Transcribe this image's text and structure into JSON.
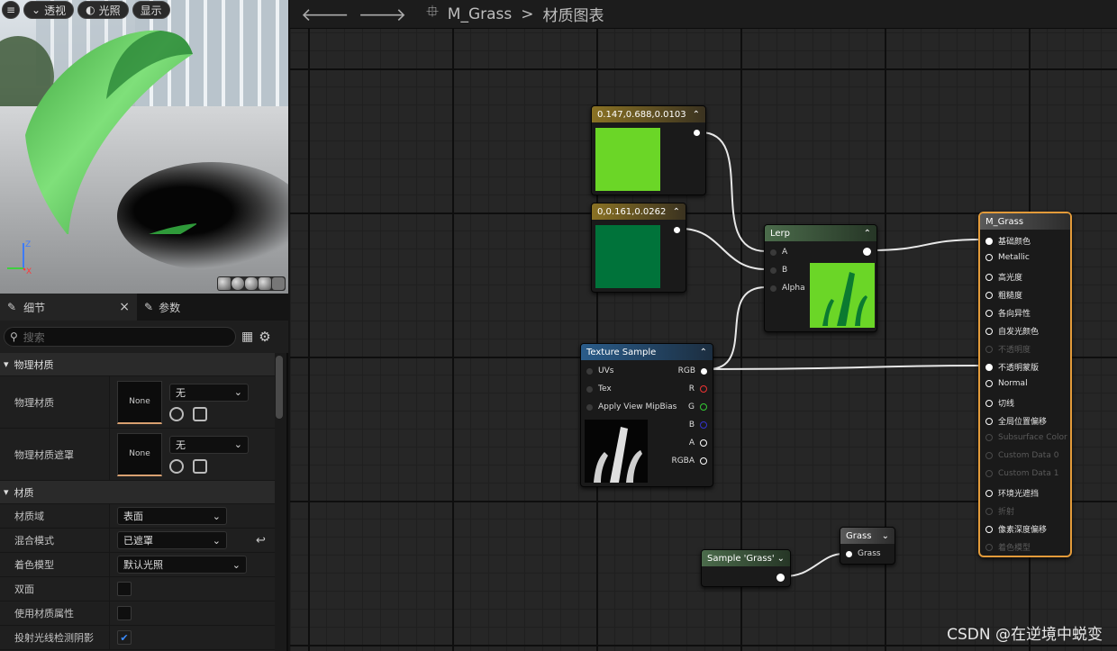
{
  "viewport": {
    "menu_label": "≡",
    "buttons": [
      {
        "label": "透视"
      },
      {
        "label": "光照"
      },
      {
        "label": "显示"
      }
    ],
    "axis": {
      "z": "Z",
      "x": "X"
    }
  },
  "tabs": {
    "details": "细节",
    "close": "×",
    "params": "参数"
  },
  "search": {
    "placeholder": "搜索"
  },
  "details": {
    "cat_physical": "物理材质",
    "phys_mat_label": "物理材质",
    "phys_mat_thumb": "None",
    "phys_mat_value": "无",
    "phys_mask_label": "物理材质遮罩",
    "phys_mask_thumb": "None",
    "phys_mask_value": "无",
    "cat_material": "材质",
    "domain_label": "材质域",
    "domain_value": "表面",
    "blend_label": "混合模式",
    "blend_value": "已遮罩",
    "shading_label": "着色模型",
    "shading_value": "默认光照",
    "twosided_label": "双面",
    "matattr_label": "使用材质属性",
    "raytrace_label": "投射光线检测阴影",
    "raytrace_checked": true
  },
  "graph": {
    "breadcrumb_asset": "M_Grass",
    "breadcrumb_sep": ">",
    "breadcrumb_page": "材质图表",
    "nodes": {
      "const1": {
        "title": "0.147,0.688,0.0103",
        "color": "#6bd627"
      },
      "const2": {
        "title": "0,0.161,0.0262",
        "color": "#00733a"
      },
      "lerp": {
        "title": "Lerp",
        "a": "A",
        "b": "B",
        "alpha": "Alpha"
      },
      "tex": {
        "title": "Texture Sample",
        "uvs": "UVs",
        "tex": "Tex",
        "mip": "Apply View MipBias",
        "rgb": "RGB",
        "r": "R",
        "g": "G",
        "b": "B",
        "a": "A",
        "rgba": "RGBA"
      },
      "mat": {
        "title": "M_Grass",
        "pins": [
          {
            "label": "基础颜色",
            "on": true
          },
          {
            "label": "Metallic",
            "on": true
          },
          {
            "label": "高光度",
            "on": true
          },
          {
            "label": "粗糙度",
            "on": true
          },
          {
            "label": "各向异性",
            "on": true
          },
          {
            "label": "自发光颜色",
            "on": true
          },
          {
            "label": "不透明度",
            "on": false
          },
          {
            "label": "不透明蒙版",
            "on": true
          },
          {
            "label": "Normal",
            "on": true
          },
          {
            "label": "切线",
            "on": true
          },
          {
            "label": "全局位置偏移",
            "on": true
          },
          {
            "label": "Subsurface Color",
            "on": false
          },
          {
            "label": "Custom Data 0",
            "on": false
          },
          {
            "label": "Custom Data 1",
            "on": false
          },
          {
            "label": "环境光遮挡",
            "on": true
          },
          {
            "label": "折射",
            "on": false
          },
          {
            "label": "像素深度偏移",
            "on": true
          },
          {
            "label": "着色模型",
            "on": false
          }
        ]
      },
      "sample": {
        "title": "Sample 'Grass'"
      },
      "grass": {
        "title": "Grass",
        "pin": "Grass"
      }
    }
  },
  "watermark": "CSDN @在逆境中蜕变",
  "colors": {
    "accent_orange": "#e39b3a",
    "lerp_head": "#4b6b4b",
    "tex_head": "#2a5c8a",
    "const_head": "#8a7224"
  }
}
